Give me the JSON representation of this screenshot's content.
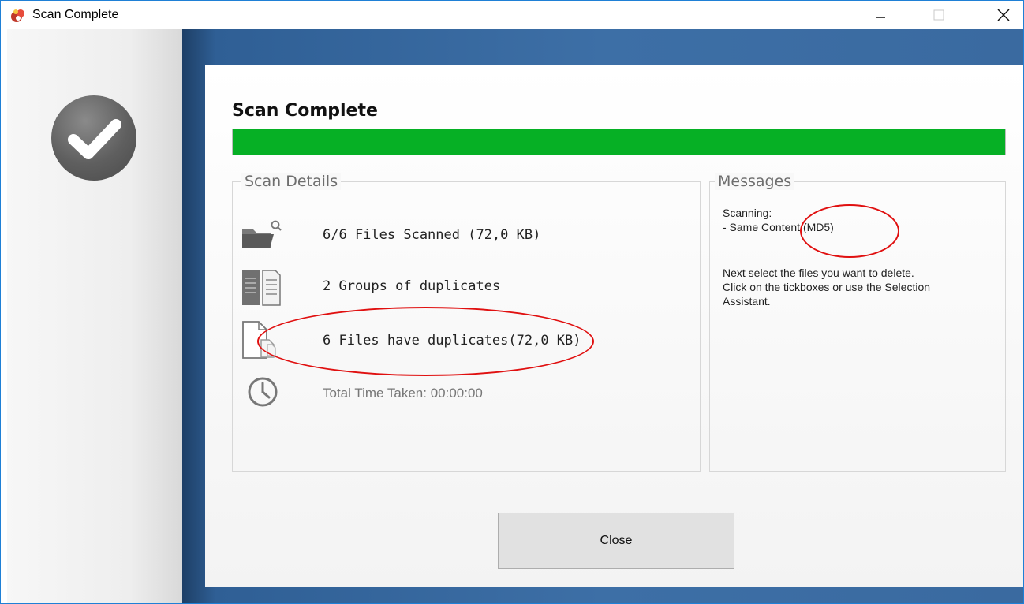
{
  "window": {
    "title": "Scan Complete",
    "controls": [
      "minimize",
      "maximize",
      "close"
    ]
  },
  "sidebar": {
    "status_icon": "checkmark-circle-icon"
  },
  "main": {
    "heading": "Scan Complete",
    "progress_percent": 100,
    "progress_color": "#06b025"
  },
  "scan_details": {
    "legend": "Scan Details",
    "files_scanned": "6/6 Files Scanned (72,0 KB)",
    "groups": "2 Groups of duplicates",
    "files_with_duplicates": "6 Files have duplicates(72,0 KB)",
    "total_time": "Total Time Taken: 00:00:00"
  },
  "messages": {
    "legend": "Messages",
    "lines": [
      "Scanning:",
      "- Same Content (MD5)",
      "",
      "Next select the files you want to delete.",
      "Click on the tickboxes or use the Selection",
      "Assistant."
    ]
  },
  "footer": {
    "close_label": "Close"
  },
  "annotations": {
    "color": "#e01010",
    "highlighted": [
      "(MD5)",
      "6 Files have duplicates(72,0 KB)"
    ]
  }
}
